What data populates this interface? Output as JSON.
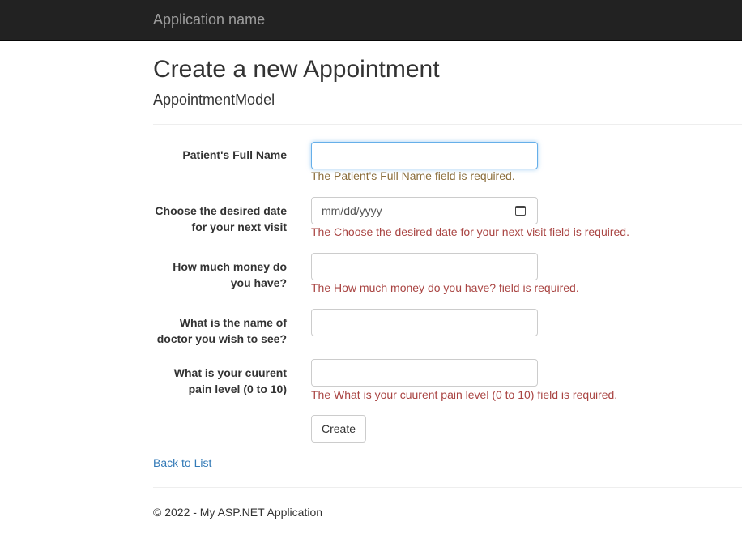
{
  "navbar": {
    "brand": "Application name"
  },
  "page": {
    "title": "Create a new Appointment",
    "subtitle": "AppointmentModel"
  },
  "form": {
    "fields": [
      {
        "label": "Patient's Full Name",
        "value": "",
        "error": "The Patient's Full Name field is required."
      },
      {
        "label_line1": "Choose the desired date",
        "label_line2": "for your next visit",
        "placeholder": "mm/dd/yyyy",
        "error": "The Choose the desired date for your next visit field is required."
      },
      {
        "label_line1": "How much money do",
        "label_line2": "you have?",
        "value": "",
        "error": "The How much money do you have? field is required."
      },
      {
        "label_line1": "What is the name of",
        "label_line2": "doctor you wish to see?",
        "value": ""
      },
      {
        "label_line1": "What is your cuurent",
        "label_line2": "pain level (0 to 10)",
        "value": "",
        "error": "The What is your cuurent pain level (0 to 10) field is required."
      }
    ],
    "submit": "Create"
  },
  "links": {
    "back": "Back to List"
  },
  "footer": {
    "text": "© 2022 - My ASP.NET Application"
  },
  "colors": {
    "error": "#a94442",
    "link": "#337ab7",
    "navbar": "#222222"
  }
}
